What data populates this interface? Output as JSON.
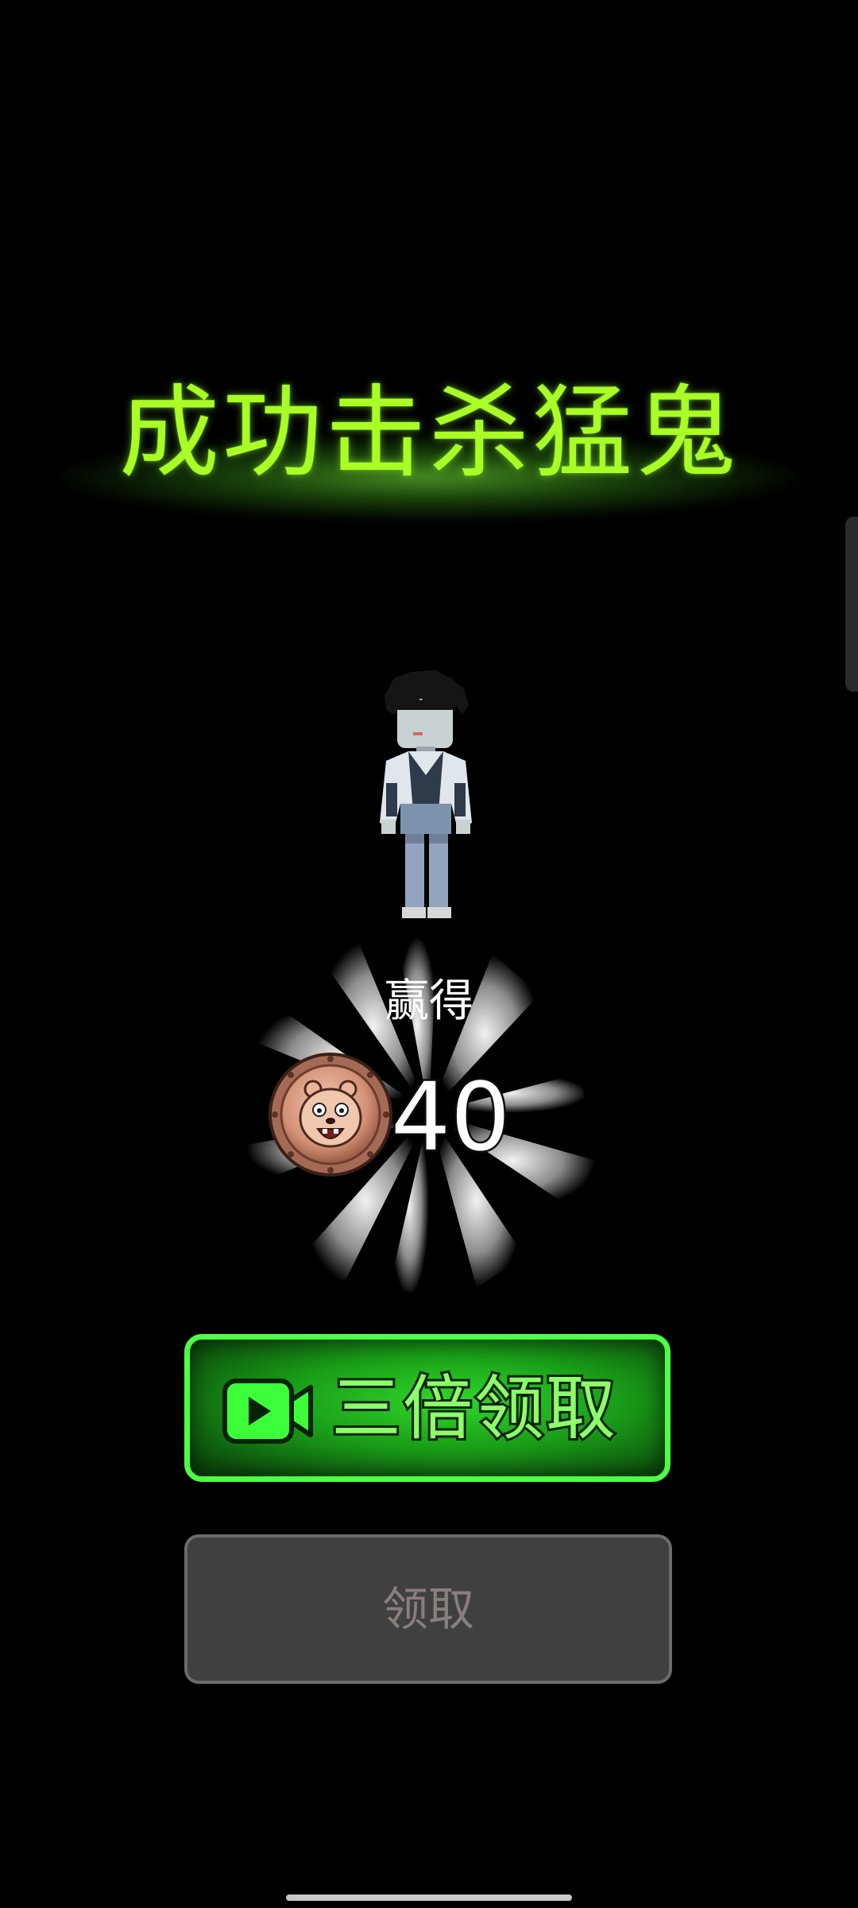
{
  "title": "成功击杀猛鬼",
  "reward": {
    "label": "赢得",
    "amount": "40",
    "currency_icon": "bear-coin-icon"
  },
  "buttons": {
    "triple_claim": {
      "label": "三倍领取",
      "icon": "video-play-icon"
    },
    "claim": {
      "label": "领取"
    }
  },
  "colors": {
    "title": "#a9ff25",
    "triple_button_border": "#4dff45",
    "triple_button_fill": "#1a9d18",
    "claim_button_fill": "#404040",
    "claim_text": "#8a7d7d"
  }
}
